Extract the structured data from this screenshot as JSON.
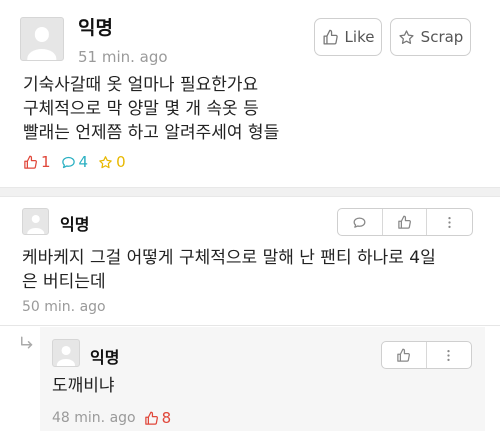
{
  "post": {
    "author": "익명",
    "time": "51 min. ago",
    "like_button": "Like",
    "scrap_button": "Scrap",
    "body_lines": [
      "기숙사갈때 옷 얼마나 필요한가요",
      "구체적으로 막 양말 몇 개 속옷 등",
      "빨래는 언제쯤 하고 알려주세여 형들"
    ],
    "stats": {
      "likes": "1",
      "comments": "4",
      "scraps": "0"
    }
  },
  "comments": [
    {
      "author": "익명",
      "body_lines": [
        "케바케지 그걸 어떻게 구체적으로 말해 난 팬티 하나로 4일",
        "은 버티는데"
      ],
      "time": "50 min. ago"
    }
  ],
  "reply": {
    "author": "익명",
    "body": "도깨비냐",
    "time": "48 min. ago",
    "likes": "8"
  },
  "colors": {
    "like": "#e0473a",
    "comment": "#2bb0c2",
    "scrap": "#e8b800",
    "muted": "#9a9a9a"
  },
  "icons": [
    "thumb-up-icon",
    "star-icon",
    "speech-bubble-icon",
    "more-vertical-icon",
    "reply-arrow-icon"
  ]
}
